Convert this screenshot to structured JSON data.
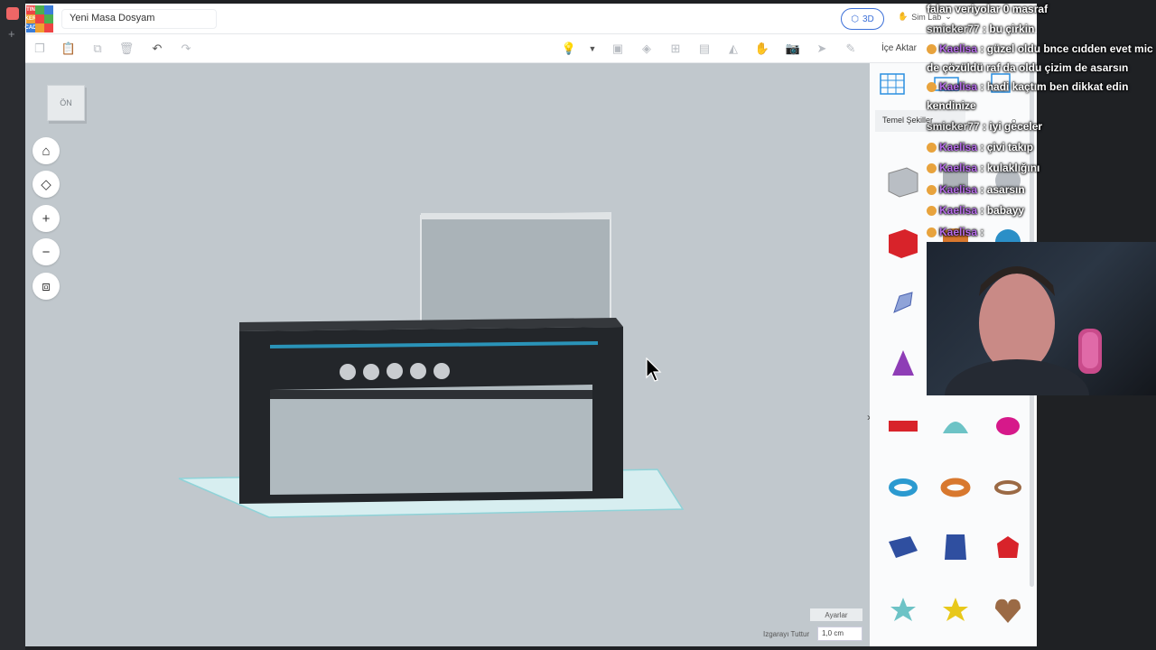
{
  "os_sidebar": {
    "add_label": "+"
  },
  "app": {
    "logo_letters": [
      "TIN",
      "KER",
      "CAD"
    ],
    "document_title": "Yeni Masa Dosyam",
    "view_mode_label": "3D",
    "simlab_label": "Sim Lab",
    "import_label": "İçe Aktar"
  },
  "viewport": {
    "view_cube_label": "ÖN",
    "settings_label": "Ayarlar",
    "snap_grid_label": "Izgarayı Tuttur",
    "snap_grid_value": "1,0 cm"
  },
  "shapes_panel": {
    "category": "Temel Şekiller",
    "shapes": [
      "box-striped",
      "cylinder-striped",
      "sphere-striped",
      "box",
      "cylinder",
      "sphere",
      "scribble",
      "cone-blue",
      "roof",
      "cone",
      "cylinder-side",
      "paraboloid",
      "text",
      "half-sphere",
      "ellipsoid",
      "torus",
      "tube",
      "ring",
      "polygon-box",
      "hexagonal-prism",
      "icosahedron",
      "star",
      "star-yellow",
      "heart"
    ],
    "colors": {
      "red": "#d8232a",
      "purple": "#8e3db6",
      "teal": "#6dc3c6",
      "magenta": "#d6198a",
      "blue": "#2f4fa0",
      "orange": "#d8782e",
      "brown": "#9b6a45"
    }
  },
  "chat": {
    "messages": [
      {
        "text": "falan veriyolar 0 masraf"
      },
      {
        "user": "smicker77",
        "text": " : bu çirkin"
      },
      {
        "user": "Kaelisa",
        "text": " : güzel oldu bnce cıdden evet mic de çözüldü raf da oldu çizim de asarsın"
      },
      {
        "user": "Kaelisa",
        "text": " : hadi kaçtım ben dikkat edin kendinize"
      },
      {
        "user": "smicker77",
        "text": " : iyi geceler"
      },
      {
        "user": "Kaelisa",
        "text": " : çivi takıp"
      },
      {
        "user": "Kaelisa",
        "text": " : kulaklığını"
      },
      {
        "user": "Kaelisa",
        "text": " : asarsın"
      },
      {
        "user": "Kaelisa",
        "text": " : babayy"
      },
      {
        "user": "Kaelisa",
        "text": " : "
      }
    ]
  }
}
